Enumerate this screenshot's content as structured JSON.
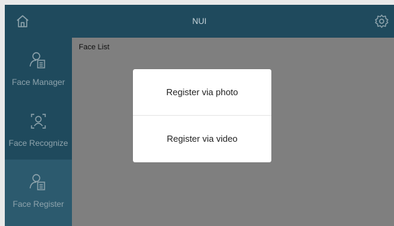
{
  "header": {
    "title": "NUI",
    "home_icon": "home-icon",
    "settings_icon": "gear-icon"
  },
  "sidebar": {
    "items": [
      {
        "label": "Face Manager",
        "icon": "face-list-icon",
        "active": false
      },
      {
        "label": "Face Recognize",
        "icon": "face-scan-icon",
        "active": false
      },
      {
        "label": "Face Register",
        "icon": "face-list-icon",
        "active": true
      }
    ]
  },
  "main": {
    "title": "Face List"
  },
  "dialog": {
    "options": [
      {
        "label": "Register via photo"
      },
      {
        "label": "Register via video"
      }
    ]
  },
  "colors": {
    "header_bg": "#1f4a5d",
    "sidebar_bg": "#1f4a5d",
    "sidebar_active_bg": "#2c5a6e",
    "overlay": "#7f7f7f",
    "dialog_bg": "#ffffff"
  }
}
